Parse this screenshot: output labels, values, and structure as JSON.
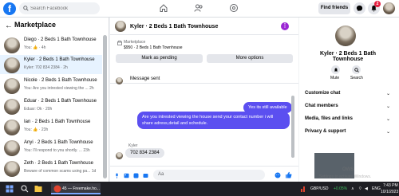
{
  "topbar": {
    "search_placeholder": "Search Facebook",
    "find_friends": "Find friends",
    "notification_count": "2"
  },
  "sidebar": {
    "title": "Marketplace",
    "conversations": [
      {
        "name": "Diego · 2 Beds 1 Bath Townhouse",
        "preview": "You: 👍 · 4h"
      },
      {
        "name": "Kyler · 2 Beds 1 Bath Townhouse",
        "preview": "Kyler: 702 834 2384 · 2h"
      },
      {
        "name": "Nicole · 2 Beds 1 Bath Townhouse",
        "preview": "You: Are you intrested viewing the ... 2h"
      },
      {
        "name": "Eduar · 2 Beds 1 Bath Townhouse",
        "preview": "Eduar: Ok · 20h"
      },
      {
        "name": "Ian · 2 Beds 1 Bath Townhouse",
        "preview": "You: 👍 · 23h"
      },
      {
        "name": "Anyi · 2 Beds 1 Bath Townhouse",
        "preview": "You: I'll respond to you shortly. ... 23h"
      },
      {
        "name": "Zeth · 2 Beds 1 Bath Townhouse",
        "preview": "Beware of common scams using pa... 1d"
      }
    ]
  },
  "chat": {
    "title": "Kyler · 2 Beds 1 Bath Townhouse",
    "marketplace_label": "Marketplace",
    "listing": "$950 · 2 Beds 1 Bath Townhouse",
    "mark_pending": "Mark as pending",
    "more_options": "More options",
    "messages": {
      "sent_notice": "Message sent",
      "out1": "Yes its still available",
      "out2": "Are you intrested viewing the house send your contact number i will share adress,detail and schedule.",
      "sender": "Kyler",
      "in1": "702 834 2384"
    },
    "composer_placeholder": "Aa"
  },
  "right_panel": {
    "name": "Kyler · 2 Beds 1 Bath Townhouse",
    "mute": "Mute",
    "search": "Search",
    "sections": [
      "Customize chat",
      "Chat members",
      "Media, files and links",
      "Privacy & support"
    ]
  },
  "watermark": {
    "line1": "ows",
    "line2": "Settings to activate Windows."
  },
  "taskbar": {
    "app_title": "45 — Freemake.ho...",
    "currency": "GBP/USD",
    "change": "+0.05%",
    "lang": "ENG",
    "time": "7:43 PM",
    "date": "10/1/2023"
  }
}
